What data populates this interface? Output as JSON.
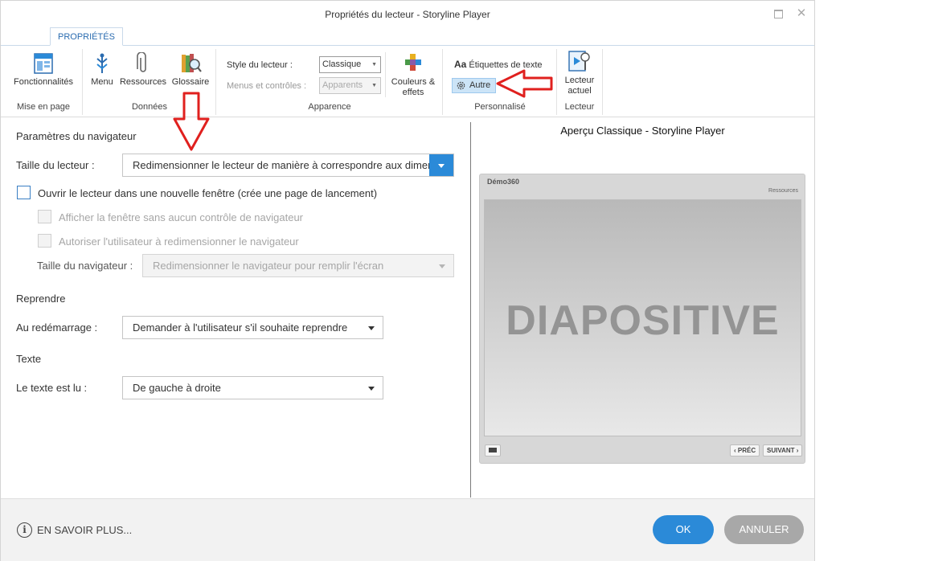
{
  "window": {
    "title": "Propriétés du lecteur - Storyline Player",
    "maximize_icon": "maximize-icon",
    "close_label": "✕"
  },
  "ribbon": {
    "tab": "PROPRIÉTÉS",
    "groups": {
      "layout": {
        "label": "Mise en page",
        "features_label": "Fonctionnalités"
      },
      "data": {
        "label": "Données",
        "menu_label": "Menu",
        "resources_label": "Ressources",
        "glossary_label": "Glossaire"
      },
      "appearance": {
        "label": "Apparence",
        "player_style_label": "Style du lecteur :",
        "player_style_value": "Classique",
        "menus_controls_label": "Menus et contrôles :",
        "menus_controls_value": "Apparents",
        "colors_effects_line1": "Couleurs &",
        "colors_effects_line2": "effets"
      },
      "custom": {
        "label": "Personnalisé",
        "text_labels_prefix": "Aa",
        "text_labels": "Étiquettes de texte",
        "other": "Autre"
      },
      "player": {
        "label": "Lecteur",
        "current_player_line1": "Lecteur",
        "current_player_line2": "actuel"
      }
    }
  },
  "settings": {
    "browser_section": "Paramètres du navigateur",
    "player_size_label": "Taille du lecteur :",
    "player_size_value": "Redimensionner le lecteur de manière à correspondre aux dimensions de la fenêtre du navigateur",
    "open_new_window_label": "Ouvrir le lecteur dans une nouvelle fenêtre (crée une page de lancement)",
    "no_controls_label": "Afficher la fenêtre sans aucun contrôle de navigateur",
    "allow_resize_label": "Autoriser l'utilisateur à redimensionner le navigateur",
    "browser_size_label": "Taille du navigateur :",
    "browser_size_value": "Redimensionner le navigateur pour remplir l'écran",
    "resume_section": "Reprendre",
    "on_restart_label": "Au redémarrage :",
    "on_restart_value": "Demander à l'utilisateur s'il souhaite reprendre",
    "text_section": "Texte",
    "text_direction_label": "Le texte est lu :",
    "text_direction_value": "De gauche à droite"
  },
  "preview": {
    "title": "Aperçu Classique - Storyline Player",
    "course_name": "Démo360",
    "resources_link": "Ressources",
    "slide_text": "DIAPOSITIVE",
    "prev_button": "‹ PRÉC",
    "next_button": "SUIVANT ›",
    "notes_icon": "caption-icon"
  },
  "footer": {
    "learn_more": "EN SAVOIR PLUS...",
    "ok": "OK",
    "cancel": "ANNULER"
  },
  "colors": {
    "accent_blue": "#2b8ad8",
    "annotation_red": "#e0201e",
    "cancel_gray": "#a8a8a8"
  }
}
